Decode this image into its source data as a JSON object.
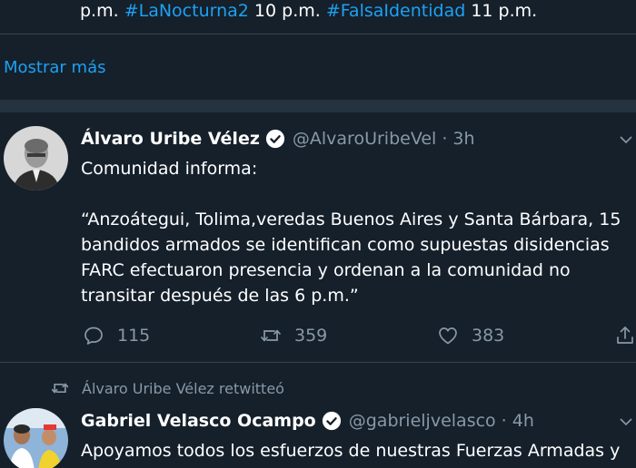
{
  "top_partial": {
    "part1": "p.m. ",
    "tag1": "#LaNocturna2",
    "part2": " 10 p.m. ",
    "tag2": "#FalsaIdentidad",
    "part3": " 11 p.m."
  },
  "show_more_label": "Mostrar más",
  "tweet1": {
    "name": "Álvaro Uribe Vélez",
    "handle": "@AlvaroUribeVel",
    "time": "· 3h",
    "text": "Comunidad informa:\n\n“Anzoátegui,  Tolima,veredas Buenos Aires y Santa Bárbara,  15 bandidos armados se identifican como supuestas disidencias FARC  efectuaron presencia y ordenan a la comunidad no transitar después de las 6 p.m.”",
    "replies": "115",
    "retweets": "359",
    "likes": "383"
  },
  "tweet2": {
    "retweeted_by": "Álvaro Uribe Vélez retwitteó",
    "name": "Gabriel Velasco Ocampo",
    "handle": "@gabrieljvelasco",
    "time": "· 4h",
    "text": "Apoyamos todos los esfuerzos de nuestras Fuerzas Armadas y"
  },
  "colors": {
    "background": "#15202b",
    "accent": "#1da1f2",
    "muted": "#8899a6",
    "divider": "#38444d"
  }
}
